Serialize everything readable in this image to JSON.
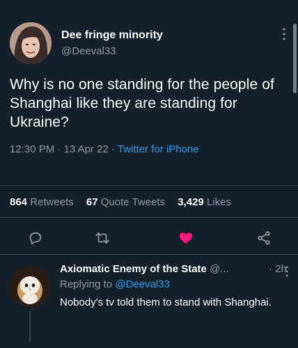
{
  "tweet": {
    "display_name": "Dee fringe minority",
    "handle": "@Deeval33",
    "text": "Why is no one standing for the people of Shanghai like they are standing for Ukraine?",
    "time": "12:30 PM",
    "date": "13 Apr 22",
    "source": "Twitter for iPhone",
    "sep": " · "
  },
  "stats": {
    "retweets_count": "864",
    "retweets_label": "Retweets",
    "quotes_count": "67",
    "quotes_label": "Quote Tweets",
    "likes_count": "3,429",
    "likes_label": "Likes"
  },
  "actions": {
    "reply": "reply-icon",
    "retweet": "retweet-icon",
    "like": "heart-icon-filled",
    "share": "share-icon"
  },
  "reply": {
    "display_name": "Axiomatic Enemy of the State",
    "handle": "@...",
    "sep": " · ",
    "time": "2h",
    "replying_prefix": "Replying to ",
    "replying_to": "@Deeval33",
    "text": "Nobody's tv told them to stand with Shanghai."
  },
  "colors": {
    "background": "#15202b",
    "accent": "#1d9bf0",
    "like": "#f91880",
    "secondary_text": "#8b98a5"
  }
}
